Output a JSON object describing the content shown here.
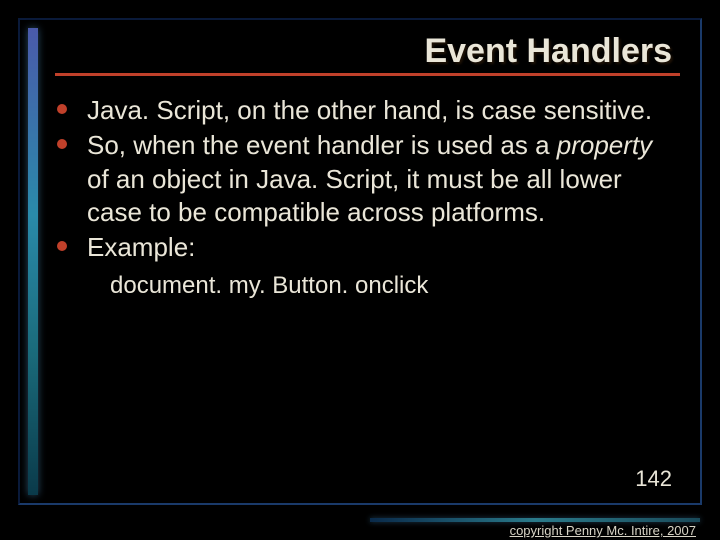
{
  "title": "Event Handlers",
  "bullets": [
    {
      "pre": "Java. Script, on the other hand, is case sensitive."
    },
    {
      "pre": "So, when the event handler is used as a ",
      "em": "property",
      "post": " of an object in Java. Script, it must be all lower case to be compatible across platforms."
    },
    {
      "pre": "Example:"
    }
  ],
  "code": "document. my. Button. onclick",
  "page_number": "142",
  "copyright": "copyright Penny Mc. Intire, 2007"
}
